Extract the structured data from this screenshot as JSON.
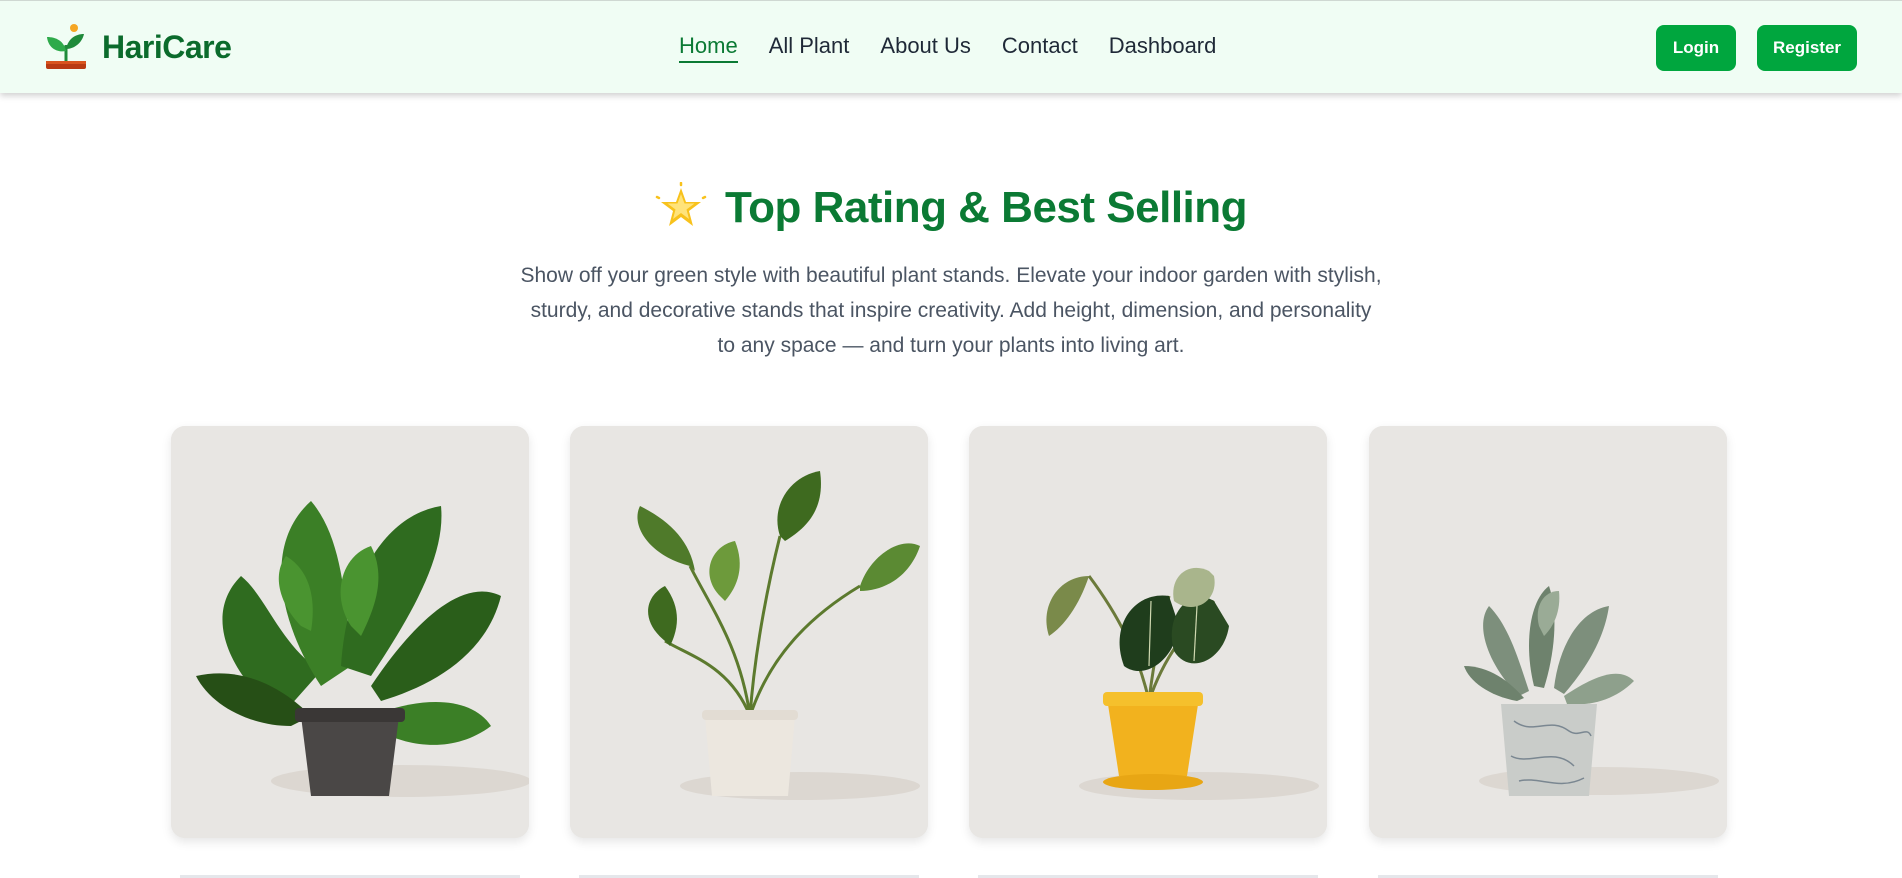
{
  "brand": {
    "name": "HariCare",
    "logo_icon": "sprout-pot-icon"
  },
  "nav": {
    "links": [
      "Home",
      "All Plant",
      "About Us",
      "Contact",
      "Dashboard"
    ],
    "active": "Home"
  },
  "auth": {
    "login_label": "Login",
    "register_label": "Register"
  },
  "section": {
    "title": "Top Rating & Best Selling",
    "icon": "glowing-star-icon",
    "description": "Show off your green style with beautiful plant stands. Elevate your indoor garden with stylish, sturdy, and decorative stands that inspire creativity. Add height, dimension, and personality to any space — and turn your plants into living art."
  },
  "products": [
    {
      "image": "monstera-plant-dark-pot"
    },
    {
      "image": "alocasia-plant-cream-pot"
    },
    {
      "image": "anthurium-plant-yellow-pot"
    },
    {
      "image": "silver-plant-marble-pot"
    }
  ],
  "colors": {
    "brand_green": "#0b7a34",
    "button_green": "#00a63e",
    "nav_bg": "#f0fdf4"
  }
}
